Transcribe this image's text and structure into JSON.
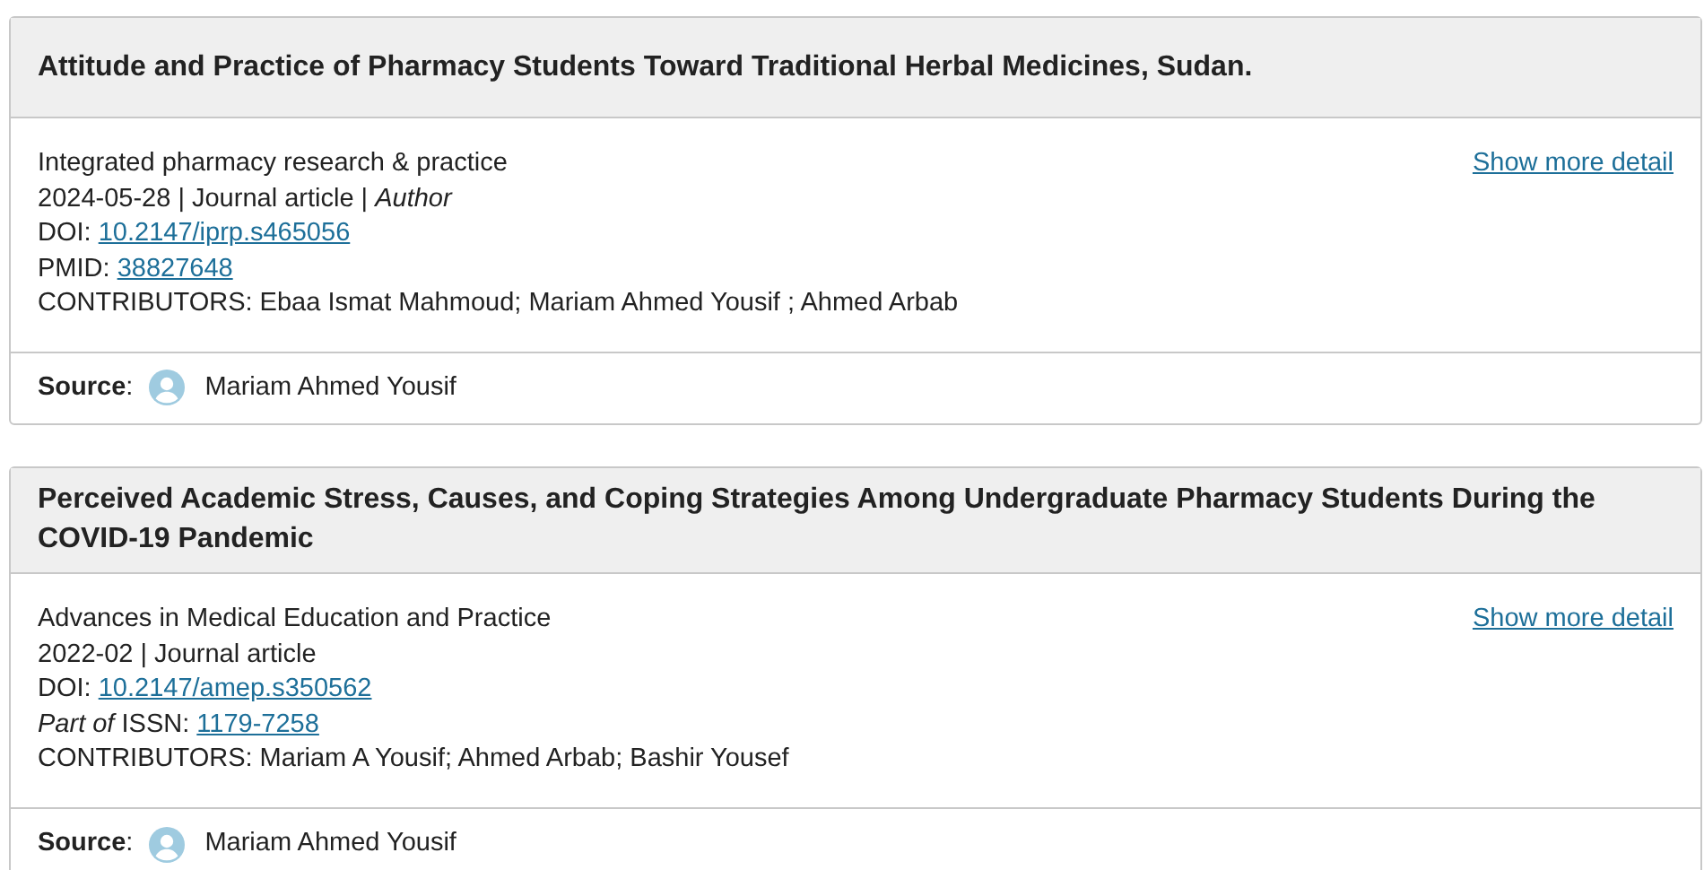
{
  "works": [
    {
      "title": "Attitude and Practice of Pharmacy Students Toward Traditional Herbal Medicines, Sudan.",
      "journal": "Integrated pharmacy research & practice",
      "meta": "2024-05-28 | Journal article | *Author*",
      "identifiers": [
        {
          "label": "DOI:",
          "value": "10.2147/iprp.s465056"
        },
        {
          "label": "PMID:",
          "value": "38827648"
        }
      ],
      "contributors": "CONTRIBUTORS: Ebaa Ismat Mahmoud; Mariam Ahmed Yousif ; Ahmed Arbab",
      "show_more": "Show more detail",
      "source_label": "**Source**:",
      "source_name": "Mariam Ahmed Yousif"
    },
    {
      "title": "Perceived Academic Stress, Causes, and Coping Strategies Among Undergraduate Pharmacy Students During the COVID-19 Pandemic",
      "journal": "Advances in Medical Education and Practice",
      "meta": "2022-02 | Journal article",
      "identifiers": [
        {
          "label": "DOI:",
          "value": "10.2147/amep.s350562"
        },
        {
          "label": "*Part of* ISSN:",
          "value": "1179-7258"
        }
      ],
      "contributors": "CONTRIBUTORS: Mariam A Yousif; Ahmed Arbab; Bashir Yousef",
      "show_more": "Show more detail",
      "source_label": "**Source**:",
      "source_name": "Mariam Ahmed Yousif"
    }
  ]
}
